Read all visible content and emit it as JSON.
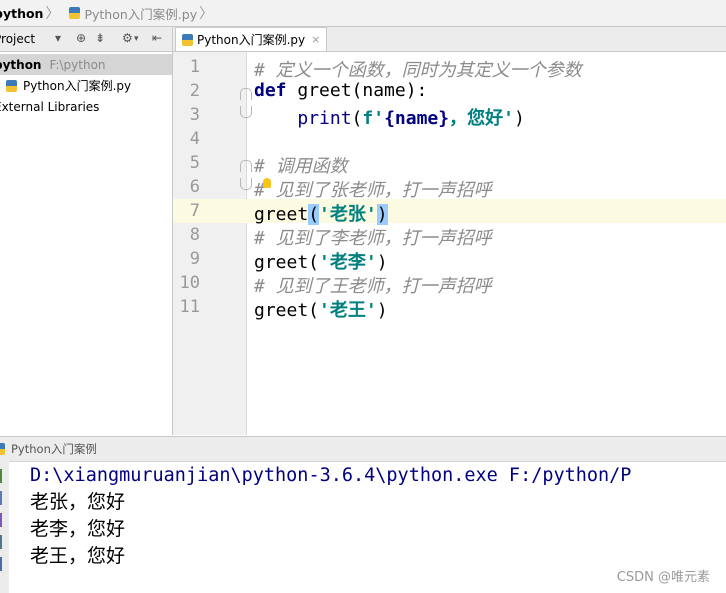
{
  "breadcrumb": {
    "root": "python",
    "file": "Python入门案例.py"
  },
  "project_panel": {
    "title": "Project",
    "tree": {
      "root_name": "python",
      "root_path": "F:\\python",
      "file_name": "Python入门案例.py",
      "external": "External Libraries"
    }
  },
  "editor": {
    "tab_label": "Python入门案例.py",
    "tab_close": "×",
    "current_line": 7,
    "lines": [
      {
        "n": "1",
        "parts": [
          {
            "t": "# 定义一个函数，同时为其定义一个参数",
            "c": "cmt"
          }
        ]
      },
      {
        "n": "2",
        "parts": [
          {
            "t": "def",
            "c": "kw"
          },
          {
            "t": " greet(name):",
            "c": ""
          }
        ]
      },
      {
        "n": "3",
        "parts": [
          {
            "t": "    ",
            "c": ""
          },
          {
            "t": "print",
            "c": "bi"
          },
          {
            "t": "(",
            "c": ""
          },
          {
            "t": "f'",
            "c": "str"
          },
          {
            "t": "{name}",
            "c": "kw"
          },
          {
            "t": "，您好'",
            "c": "str"
          },
          {
            "t": ")",
            "c": ""
          }
        ]
      },
      {
        "n": "4",
        "parts": []
      },
      {
        "n": "5",
        "parts": [
          {
            "t": "# 调用函数",
            "c": "cmt"
          }
        ]
      },
      {
        "n": "6",
        "parts": [
          {
            "t": "# 见到了张老师，打一声招呼",
            "c": "cmt"
          }
        ]
      },
      {
        "n": "7",
        "parts": [
          {
            "t": "greet",
            "c": ""
          },
          {
            "t": "(",
            "c": "hl"
          },
          {
            "t": "'老张'",
            "c": "str"
          },
          {
            "t": ")",
            "c": "hl"
          }
        ]
      },
      {
        "n": "8",
        "parts": [
          {
            "t": "# 见到了李老师，打一声招呼",
            "c": "cmt"
          }
        ]
      },
      {
        "n": "9",
        "parts": [
          {
            "t": "greet(",
            "c": ""
          },
          {
            "t": "'老李'",
            "c": "str"
          },
          {
            "t": ")",
            "c": ""
          }
        ]
      },
      {
        "n": "10",
        "parts": [
          {
            "t": "# 见到了王老师，打一声招呼",
            "c": "cmt"
          }
        ]
      },
      {
        "n": "11",
        "parts": [
          {
            "t": "greet(",
            "c": ""
          },
          {
            "t": "'老王'",
            "c": "str"
          },
          {
            "t": ")",
            "c": ""
          }
        ]
      }
    ]
  },
  "run_panel": {
    "title": "Python入门案例",
    "command": "D:\\xiangmuruanjian\\python-3.6.4\\python.exe F:/python/P",
    "output": [
      "老张，您好",
      "老李，您好",
      "老王，您好"
    ]
  },
  "watermark": "CSDN @唯元素",
  "colors": {
    "keyword": "#000080",
    "string": "#008080",
    "comment": "#8c8c8c",
    "current_line": "#fcfae1",
    "brace_highlight": "#99ccff"
  }
}
